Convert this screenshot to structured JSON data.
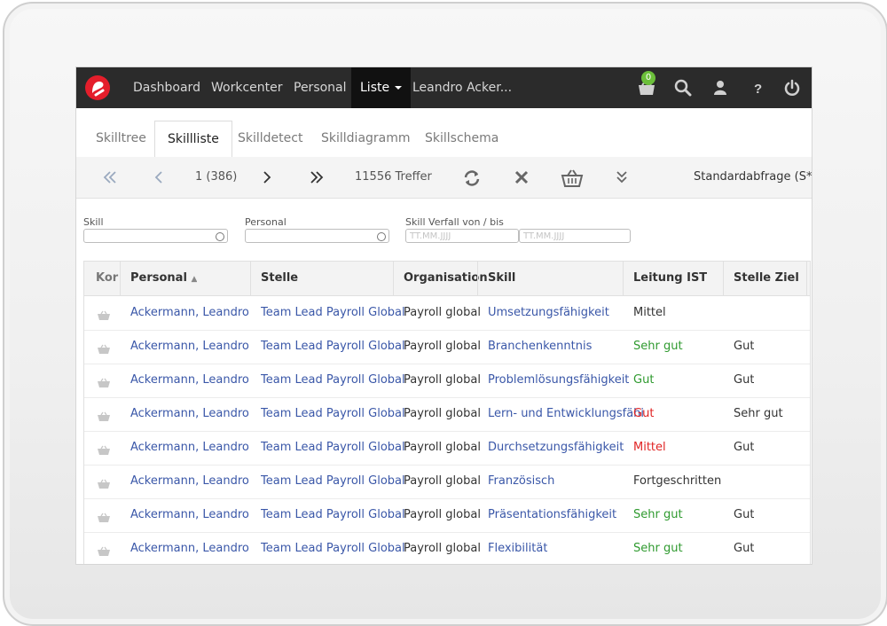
{
  "nav": {
    "items": [
      "Dashboard",
      "Workcenter",
      "Personal"
    ],
    "active": "Liste",
    "user": "Leandro Acker...",
    "basket_count": "0"
  },
  "tabs": [
    "Skilltree",
    "Skillliste",
    "Skilldetect",
    "Skilldiagramm",
    "Skillschema"
  ],
  "toolbar": {
    "page": "1 (386)",
    "hits": "11556 Treffer",
    "query": "Standardabfrage (S*)"
  },
  "filters": {
    "skill_label": "Skill",
    "personal_label": "Personal",
    "verfall_label": "Skill Verfall von / bis",
    "date_placeholder": "TT.MM.JJJJ"
  },
  "table": {
    "headers": [
      "Korb",
      "Personal",
      "Stelle",
      "Organisation",
      "Skill",
      "Leitung IST",
      "Stelle Ziel"
    ],
    "rows": [
      {
        "personal": "Ackermann, Leandro",
        "stelle": "Team Lead Payroll Global",
        "org": "Payroll global",
        "skill": "Umsetzungsfähigkeit",
        "ist": "Mittel",
        "ist_color": "#333333",
        "ziel": ""
      },
      {
        "personal": "Ackermann, Leandro",
        "stelle": "Team Lead Payroll Global",
        "org": "Payroll global",
        "skill": "Branchenkenntnis",
        "ist": "Sehr gut",
        "ist_color": "#2f9a2f",
        "ziel": "Gut"
      },
      {
        "personal": "Ackermann, Leandro",
        "stelle": "Team Lead Payroll Global",
        "org": "Payroll global",
        "skill": "Problemlösungsfähigkeit",
        "ist": "Gut",
        "ist_color": "#2f9a2f",
        "ziel": "Gut"
      },
      {
        "personal": "Ackermann, Leandro",
        "stelle": "Team Lead Payroll Global",
        "org": "Payroll global",
        "skill": "Lern- und Entwicklungsfähi",
        "ist": "Gut",
        "ist_color": "#e02424",
        "ziel": "Sehr gut"
      },
      {
        "personal": "Ackermann, Leandro",
        "stelle": "Team Lead Payroll Global",
        "org": "Payroll global",
        "skill": "Durchsetzungsfähigkeit",
        "ist": "Mittel",
        "ist_color": "#e02424",
        "ziel": "Gut"
      },
      {
        "personal": "Ackermann, Leandro",
        "stelle": "Team Lead Payroll Global",
        "org": "Payroll global",
        "skill": "Französisch",
        "ist": "Fortgeschritten",
        "ist_color": "#333333",
        "ziel": ""
      },
      {
        "personal": "Ackermann, Leandro",
        "stelle": "Team Lead Payroll Global",
        "org": "Payroll global",
        "skill": "Präsentationsfähigkeit",
        "ist": "Sehr gut",
        "ist_color": "#2f9a2f",
        "ziel": "Gut"
      },
      {
        "personal": "Ackermann, Leandro",
        "stelle": "Team Lead Payroll Global",
        "org": "Payroll global",
        "skill": "Flexibilität",
        "ist": "Sehr gut",
        "ist_color": "#2f9a2f",
        "ziel": "Gut"
      }
    ]
  }
}
